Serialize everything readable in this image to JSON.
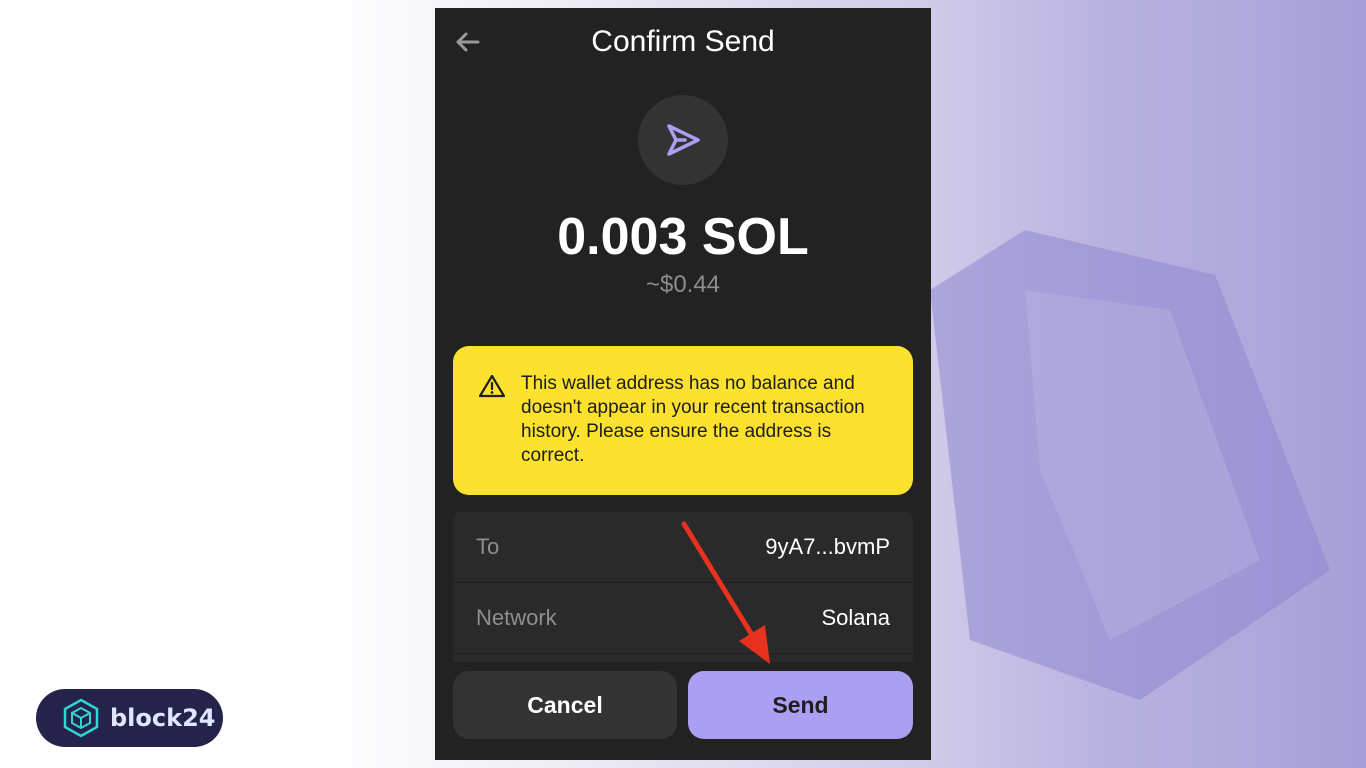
{
  "dialog": {
    "title": "Confirm Send",
    "amount": "0.003 SOL",
    "fiat_value": "~$0.44"
  },
  "warning": {
    "message": "This wallet address has no balance and doesn't appear in your recent transaction history. Please ensure the address is correct.",
    "color": "#fde12f"
  },
  "details": {
    "rows": [
      {
        "label": "To",
        "value": "9yA7...bvmP"
      },
      {
        "label": "Network",
        "value": "Solana"
      }
    ]
  },
  "actions": {
    "cancel_label": "Cancel",
    "send_label": "Send",
    "send_color": "#ab9ff2"
  },
  "branding": {
    "logo_text": "block24"
  },
  "icons": {
    "back": "arrow-left-icon",
    "send": "send-arrow-icon",
    "warning": "warning-triangle-icon",
    "annotation": "red-arrow-annotation"
  }
}
